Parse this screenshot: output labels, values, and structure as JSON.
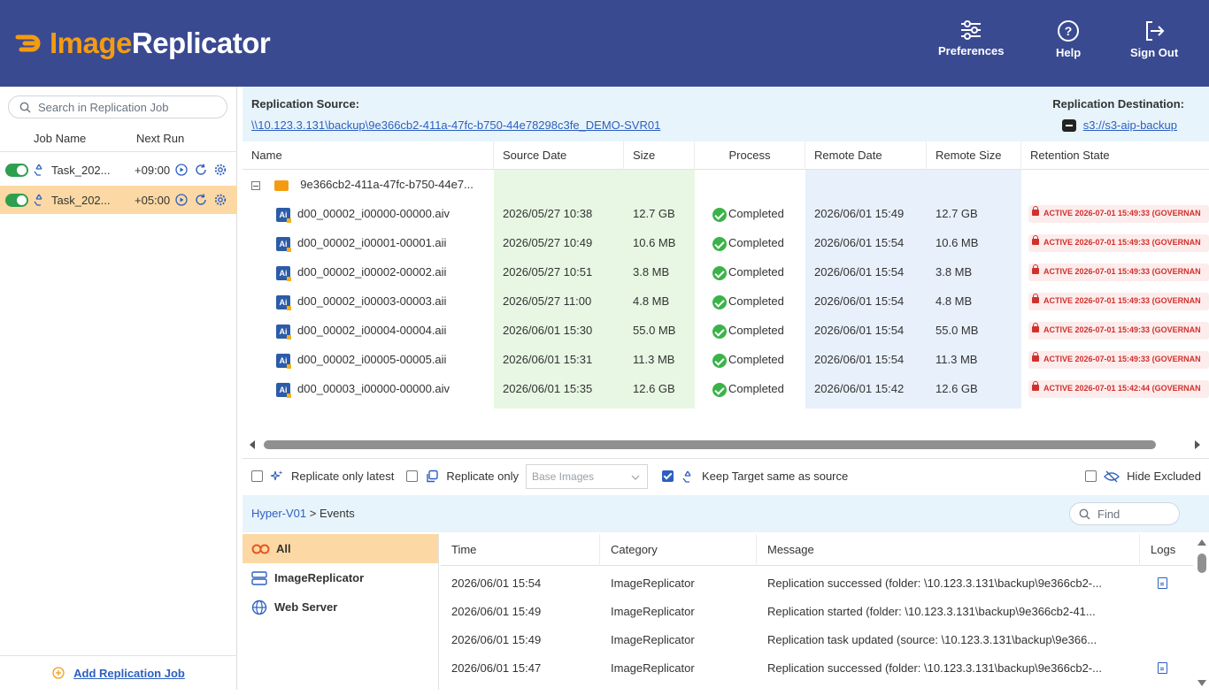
{
  "app": {
    "logo_part1": "Image",
    "logo_part2": "Replicator"
  },
  "header": {
    "preferences": "Preferences",
    "help": "Help",
    "sign_out": "Sign Out"
  },
  "sidebar": {
    "search_placeholder": "Search in Replication Job",
    "col_job_name": "Job Name",
    "col_next_run": "Next Run",
    "jobs": [
      {
        "name": "Task_202...",
        "next_run": "+09:00",
        "selected": false
      },
      {
        "name": "Task_202...",
        "next_run": "+05:00",
        "selected": true
      }
    ],
    "add_job": "Add Replication Job"
  },
  "source": {
    "label": "Replication Source:",
    "path": "\\\\10.123.3.131\\backup\\9e366cb2-411a-47fc-b750-44e78298c3fe_DEMO-SVR01",
    "dest_label": "Replication Destination:",
    "dest_path": "s3://s3-aip-backup"
  },
  "grid": {
    "columns": [
      "Name",
      "Source Date",
      "Size",
      "Process",
      "Remote Date",
      "Remote Size",
      "Retention State"
    ],
    "folder": "9e366cb2-411a-47fc-b750-44e7...",
    "file_icon": "Ai",
    "rows": [
      {
        "name": "d00_00002_i00000-00000.aiv",
        "source_date": "2026/05/27 10:38",
        "size": "12.7 GB",
        "process": "Completed",
        "remote_date": "2026/06/01 15:49",
        "remote_size": "12.7 GB",
        "retention": "ACTIVE 2026-07-01 15:49:33 (GOVERNAN"
      },
      {
        "name": "d00_00002_i00001-00001.aii",
        "source_date": "2026/05/27 10:49",
        "size": "10.6 MB",
        "process": "Completed",
        "remote_date": "2026/06/01 15:54",
        "remote_size": "10.6 MB",
        "retention": "ACTIVE 2026-07-01 15:49:33 (GOVERNAN"
      },
      {
        "name": "d00_00002_i00002-00002.aii",
        "source_date": "2026/05/27 10:51",
        "size": "3.8 MB",
        "process": "Completed",
        "remote_date": "2026/06/01 15:54",
        "remote_size": "3.8 MB",
        "retention": "ACTIVE 2026-07-01 15:49:33 (GOVERNAN"
      },
      {
        "name": "d00_00002_i00003-00003.aii",
        "source_date": "2026/05/27 11:00",
        "size": "4.8 MB",
        "process": "Completed",
        "remote_date": "2026/06/01 15:54",
        "remote_size": "4.8 MB",
        "retention": "ACTIVE 2026-07-01 15:49:33 (GOVERNAN"
      },
      {
        "name": "d00_00002_i00004-00004.aii",
        "source_date": "2026/06/01 15:30",
        "size": "55.0 MB",
        "process": "Completed",
        "remote_date": "2026/06/01 15:54",
        "remote_size": "55.0 MB",
        "retention": "ACTIVE 2026-07-01 15:49:33 (GOVERNAN"
      },
      {
        "name": "d00_00002_i00005-00005.aii",
        "source_date": "2026/06/01 15:31",
        "size": "11.3 MB",
        "process": "Completed",
        "remote_date": "2026/06/01 15:54",
        "remote_size": "11.3 MB",
        "retention": "ACTIVE 2026-07-01 15:49:33 (GOVERNAN"
      },
      {
        "name": "d00_00003_i00000-00000.aiv",
        "source_date": "2026/06/01 15:35",
        "size": "12.6 GB",
        "process": "Completed",
        "remote_date": "2026/06/01 15:42",
        "remote_size": "12.6 GB",
        "retention": "ACTIVE 2026-07-01 15:42:44 (GOVERNAN"
      }
    ]
  },
  "options": {
    "replicate_latest": "Replicate only latest",
    "replicate_only": "Replicate only",
    "base_images": "Base Images",
    "keep_target": "Keep Target same as source",
    "hide_excluded": "Hide Excluded"
  },
  "events": {
    "breadcrumb_host": "Hyper-V01",
    "breadcrumb_sep": ">",
    "breadcrumb_page": "Events",
    "find_placeholder": "Find",
    "categories": [
      "All",
      "ImageReplicator",
      "Web Server"
    ],
    "columns": [
      "Time",
      "Category",
      "Message",
      "Logs"
    ],
    "rows": [
      {
        "time": "2026/06/01 15:54",
        "category": "ImageReplicator",
        "message": "Replication successed (folder: \\10.123.3.131\\backup\\9e366cb2-...",
        "log": true
      },
      {
        "time": "2026/06/01 15:49",
        "category": "ImageReplicator",
        "message": "Replication started (folder: \\10.123.3.131\\backup\\9e366cb2-41...",
        "log": false
      },
      {
        "time": "2026/06/01 15:49",
        "category": "ImageReplicator",
        "message": "Replication task updated (source: \\10.123.3.131\\backup\\9e366...",
        "log": false
      },
      {
        "time": "2026/06/01 15:47",
        "category": "ImageReplicator",
        "message": "Replication successed (folder: \\10.123.3.131\\backup\\9e366cb2-...",
        "log": true
      }
    ]
  },
  "colors": {
    "header_bg": "#3a4a91",
    "accent_orange": "#f39c12",
    "selected_row": "#fcd9a4",
    "link_blue": "#2d5fc0",
    "success_green": "#3bb34a",
    "retention_red": "#d0312d"
  }
}
